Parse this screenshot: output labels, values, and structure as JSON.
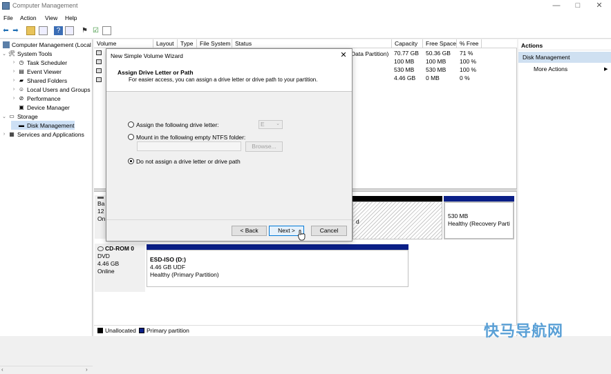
{
  "window": {
    "title": "Computer Management",
    "minimize_icon": "—",
    "maximize_icon": "□",
    "close_icon": "✕"
  },
  "menu": [
    "File",
    "Action",
    "View",
    "Help"
  ],
  "tree": {
    "root": "Computer Management (Local",
    "items": [
      {
        "label": "System Tools",
        "level": 1,
        "icon": "tools-icon",
        "glyph": "🛠",
        "expander": "⌄"
      },
      {
        "label": "Task Scheduler",
        "level": 2,
        "icon": "clock-icon",
        "glyph": "◷",
        "expander": "›"
      },
      {
        "label": "Event Viewer",
        "level": 2,
        "icon": "event-viewer-icon",
        "glyph": "▤",
        "expander": "›"
      },
      {
        "label": "Shared Folders",
        "level": 2,
        "icon": "shared-folder-icon",
        "glyph": "▰",
        "expander": "›"
      },
      {
        "label": "Local Users and Groups",
        "level": 2,
        "icon": "users-icon",
        "glyph": "☺",
        "expander": "›"
      },
      {
        "label": "Performance",
        "level": 2,
        "icon": "performance-icon",
        "glyph": "⊘",
        "expander": "›"
      },
      {
        "label": "Device Manager",
        "level": 2,
        "icon": "device-manager-icon",
        "glyph": "▣",
        "expander": ""
      },
      {
        "label": "Storage",
        "level": 1,
        "icon": "storage-icon",
        "glyph": "▭",
        "expander": "⌄"
      },
      {
        "label": "Disk Management",
        "level": 2,
        "icon": "disk-management-icon",
        "glyph": "▬",
        "expander": "",
        "selected": true
      },
      {
        "label": "Services and Applications",
        "level": 1,
        "icon": "services-icon",
        "glyph": "▦",
        "expander": "›"
      }
    ]
  },
  "volume_table": {
    "columns": [
      "Volume",
      "Layout",
      "Type",
      "File System",
      "Status",
      "Capacity",
      "Free Space",
      "% Free"
    ],
    "status_fragment": "Data Partition)",
    "rows": [
      {
        "capacity": "70.77 GB",
        "free": "50.36 GB",
        "pct": "71 %"
      },
      {
        "capacity": "100 MB",
        "free": "100 MB",
        "pct": "100 %"
      },
      {
        "capacity": "530 MB",
        "free": "530 MB",
        "pct": "100 %"
      },
      {
        "capacity": "4.46 GB",
        "free": "0 MB",
        "pct": "0 %"
      }
    ]
  },
  "disk0": {
    "label_lines": [
      "Ba",
      "12",
      "On"
    ],
    "partition_fragment": "d",
    "recovery": {
      "size": "530 MB",
      "status": "Healthy (Recovery Partit"
    }
  },
  "cdrom": {
    "name": "CD-ROM 0",
    "type": "DVD",
    "size": "4.46 GB",
    "status": "Online",
    "partition": {
      "name": "ESD-ISO  (D:)",
      "size": "4.46 GB UDF",
      "status": "Healthy (Primary Partition)"
    }
  },
  "legend": {
    "unallocated": "Unallocated",
    "primary": "Primary partition"
  },
  "actions": {
    "header": "Actions",
    "section": "Disk Management",
    "more": "More Actions",
    "more_arrow": "▶"
  },
  "wizard": {
    "title": "New Simple Volume Wizard",
    "close": "✕",
    "heading": "Assign Drive Letter or Path",
    "subheading": "For easier access, you can assign a drive letter or drive path to your partition.",
    "option1": "Assign the following drive letter:",
    "drive_letter": "E",
    "option2": "Mount in the following empty NTFS folder:",
    "browse": "Browse...",
    "option3": "Do not assign a drive letter or drive path",
    "selected_option": 3,
    "back": "< Back",
    "next": "Next >",
    "cancel": "Cancel"
  },
  "watermark": "快马导航网"
}
